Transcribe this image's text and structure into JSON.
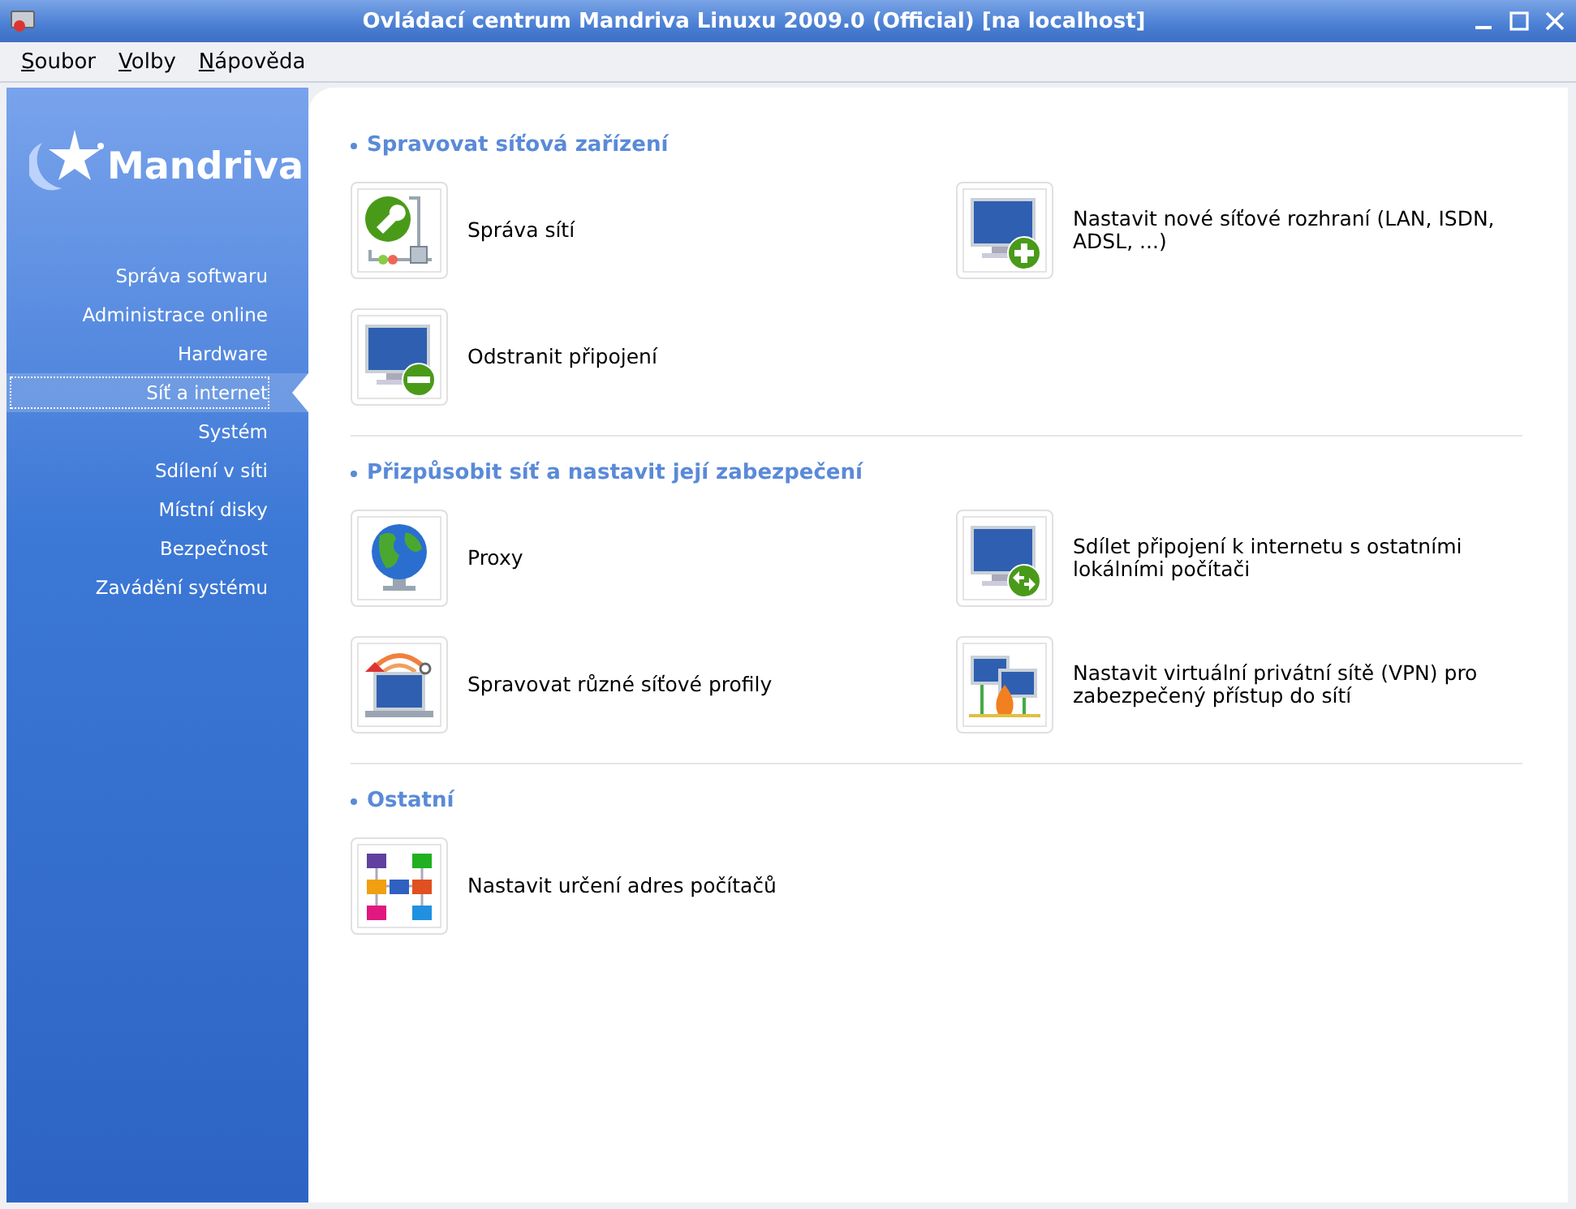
{
  "window": {
    "title": "Ovládací centrum Mandriva Linuxu 2009.0 (Official) [na localhost]"
  },
  "menu": [
    "Soubor",
    "Volby",
    "Nápověda"
  ],
  "sidebar": {
    "logo": "Mandriva",
    "items": [
      {
        "label": "Správa softwaru",
        "selected": false
      },
      {
        "label": "Administrace online",
        "selected": false
      },
      {
        "label": "Hardware",
        "selected": false
      },
      {
        "label": "Síť a internet",
        "selected": true
      },
      {
        "label": "Systém",
        "selected": false
      },
      {
        "label": "Sdílení v síti",
        "selected": false
      },
      {
        "label": "Místní disky",
        "selected": false
      },
      {
        "label": "Bezpečnost",
        "selected": false
      },
      {
        "label": "Zavádění systému",
        "selected": false
      }
    ]
  },
  "sections": [
    {
      "title": "Spravovat síťová zařízení",
      "items": [
        {
          "kind": "network-tools",
          "label": "Správa sítí"
        },
        {
          "kind": "monitor-add",
          "label": "Nastavit nové síťové rozhraní (LAN, ISDN, ADSL, ...)"
        },
        {
          "kind": "monitor-remove",
          "label": "Odstranit připojení"
        }
      ]
    },
    {
      "title": "Přizpůsobit síť a nastavit její zabezpečení",
      "items": [
        {
          "kind": "globe",
          "label": "Proxy"
        },
        {
          "kind": "monitor-share",
          "label": "Sdílet připojení k internetu s ostatními lokálními počítači"
        },
        {
          "kind": "laptop",
          "label": "Spravovat různé síťové profily"
        },
        {
          "kind": "vpn",
          "label": "Nastavit virtuální privátní sítě (VPN) pro zabezpečený přístup do sítí"
        }
      ]
    },
    {
      "title": "Ostatní",
      "items": [
        {
          "kind": "hosts",
          "label": "Nastavit určení adres počítačů"
        }
      ]
    }
  ]
}
